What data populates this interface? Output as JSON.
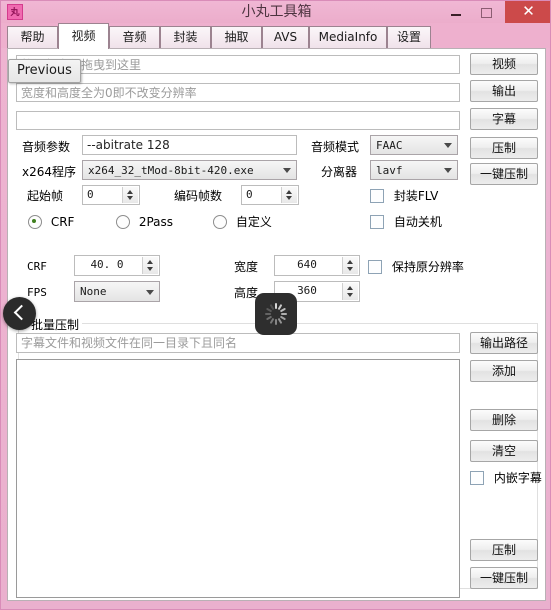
{
  "window": {
    "title": "小丸工具箱",
    "icon": "丸",
    "minimize_label": "minimize",
    "maximize_label": "maximize",
    "close_label": "✕",
    "accent_color": "#eeb0ce",
    "close_color": "#cc4a4a"
  },
  "tabs": [
    {
      "label": "帮助",
      "active": false
    },
    {
      "label": "视频",
      "active": true
    },
    {
      "label": "音频",
      "active": false
    },
    {
      "label": "封装",
      "active": false
    },
    {
      "label": "抽取",
      "active": false
    },
    {
      "label": "AVS",
      "active": false
    },
    {
      "label": "MediaInfo",
      "active": false
    },
    {
      "label": "设置",
      "active": false
    }
  ],
  "video": {
    "input_placeholder": "将视频文件拖曳到这里",
    "input_value": "",
    "output_placeholder": "宽度和高度全为0即不改变分辨率",
    "output_value": "",
    "subtitle_value": "",
    "audio_params_label": "音频参数",
    "audio_params_value": "--abitrate 128",
    "x264_label": "x264程序",
    "x264_value": "x264_32_tMod-8bit-420.exe",
    "start_frame_label": "起始帧",
    "start_frame_value": "0",
    "encode_frames_label": "编码帧数",
    "encode_frames_value": "0",
    "audio_mode_label": "音频模式",
    "audio_mode_value": "FAAC",
    "demuxer_label": "分离器",
    "demuxer_value": "lavf",
    "mux_flv_label": "封装FLV",
    "mux_flv_checked": false,
    "auto_shutdown_label": "自动关机",
    "auto_shutdown_checked": false,
    "mode_crf_label": "CRF",
    "mode_2pass_label": "2Pass",
    "mode_custom_label": "自定义",
    "mode_selected": "CRF",
    "crf_label": "CRF",
    "crf_value": "40. 0",
    "fps_label": "FPS",
    "fps_value": "None",
    "width_label": "宽度",
    "width_value": "640",
    "height_label": "高度",
    "height_value": "360",
    "keep_resolution_label": "保持原分辨率",
    "keep_resolution_checked": false,
    "buttons": {
      "video": "视频",
      "output": "输出",
      "subtitle": "字幕",
      "compress": "压制",
      "one_click": "一键压制"
    }
  },
  "batch": {
    "group_title": "批量压制",
    "subtitle_hint_placeholder": "字幕文件和视频文件在同一目录下且同名",
    "subtitle_hint_value": "",
    "list_items": [],
    "embed_subtitle_label": "内嵌字幕",
    "embed_subtitle_checked": false,
    "buttons": {
      "output_path": "输出路径",
      "add": "添加",
      "delete": "删除",
      "clear": "清空",
      "compress": "压制",
      "one_click": "一键压制"
    }
  },
  "overlays": {
    "tooltip_previous": "Previous",
    "back_button_name": "back",
    "loading_visible": true
  }
}
